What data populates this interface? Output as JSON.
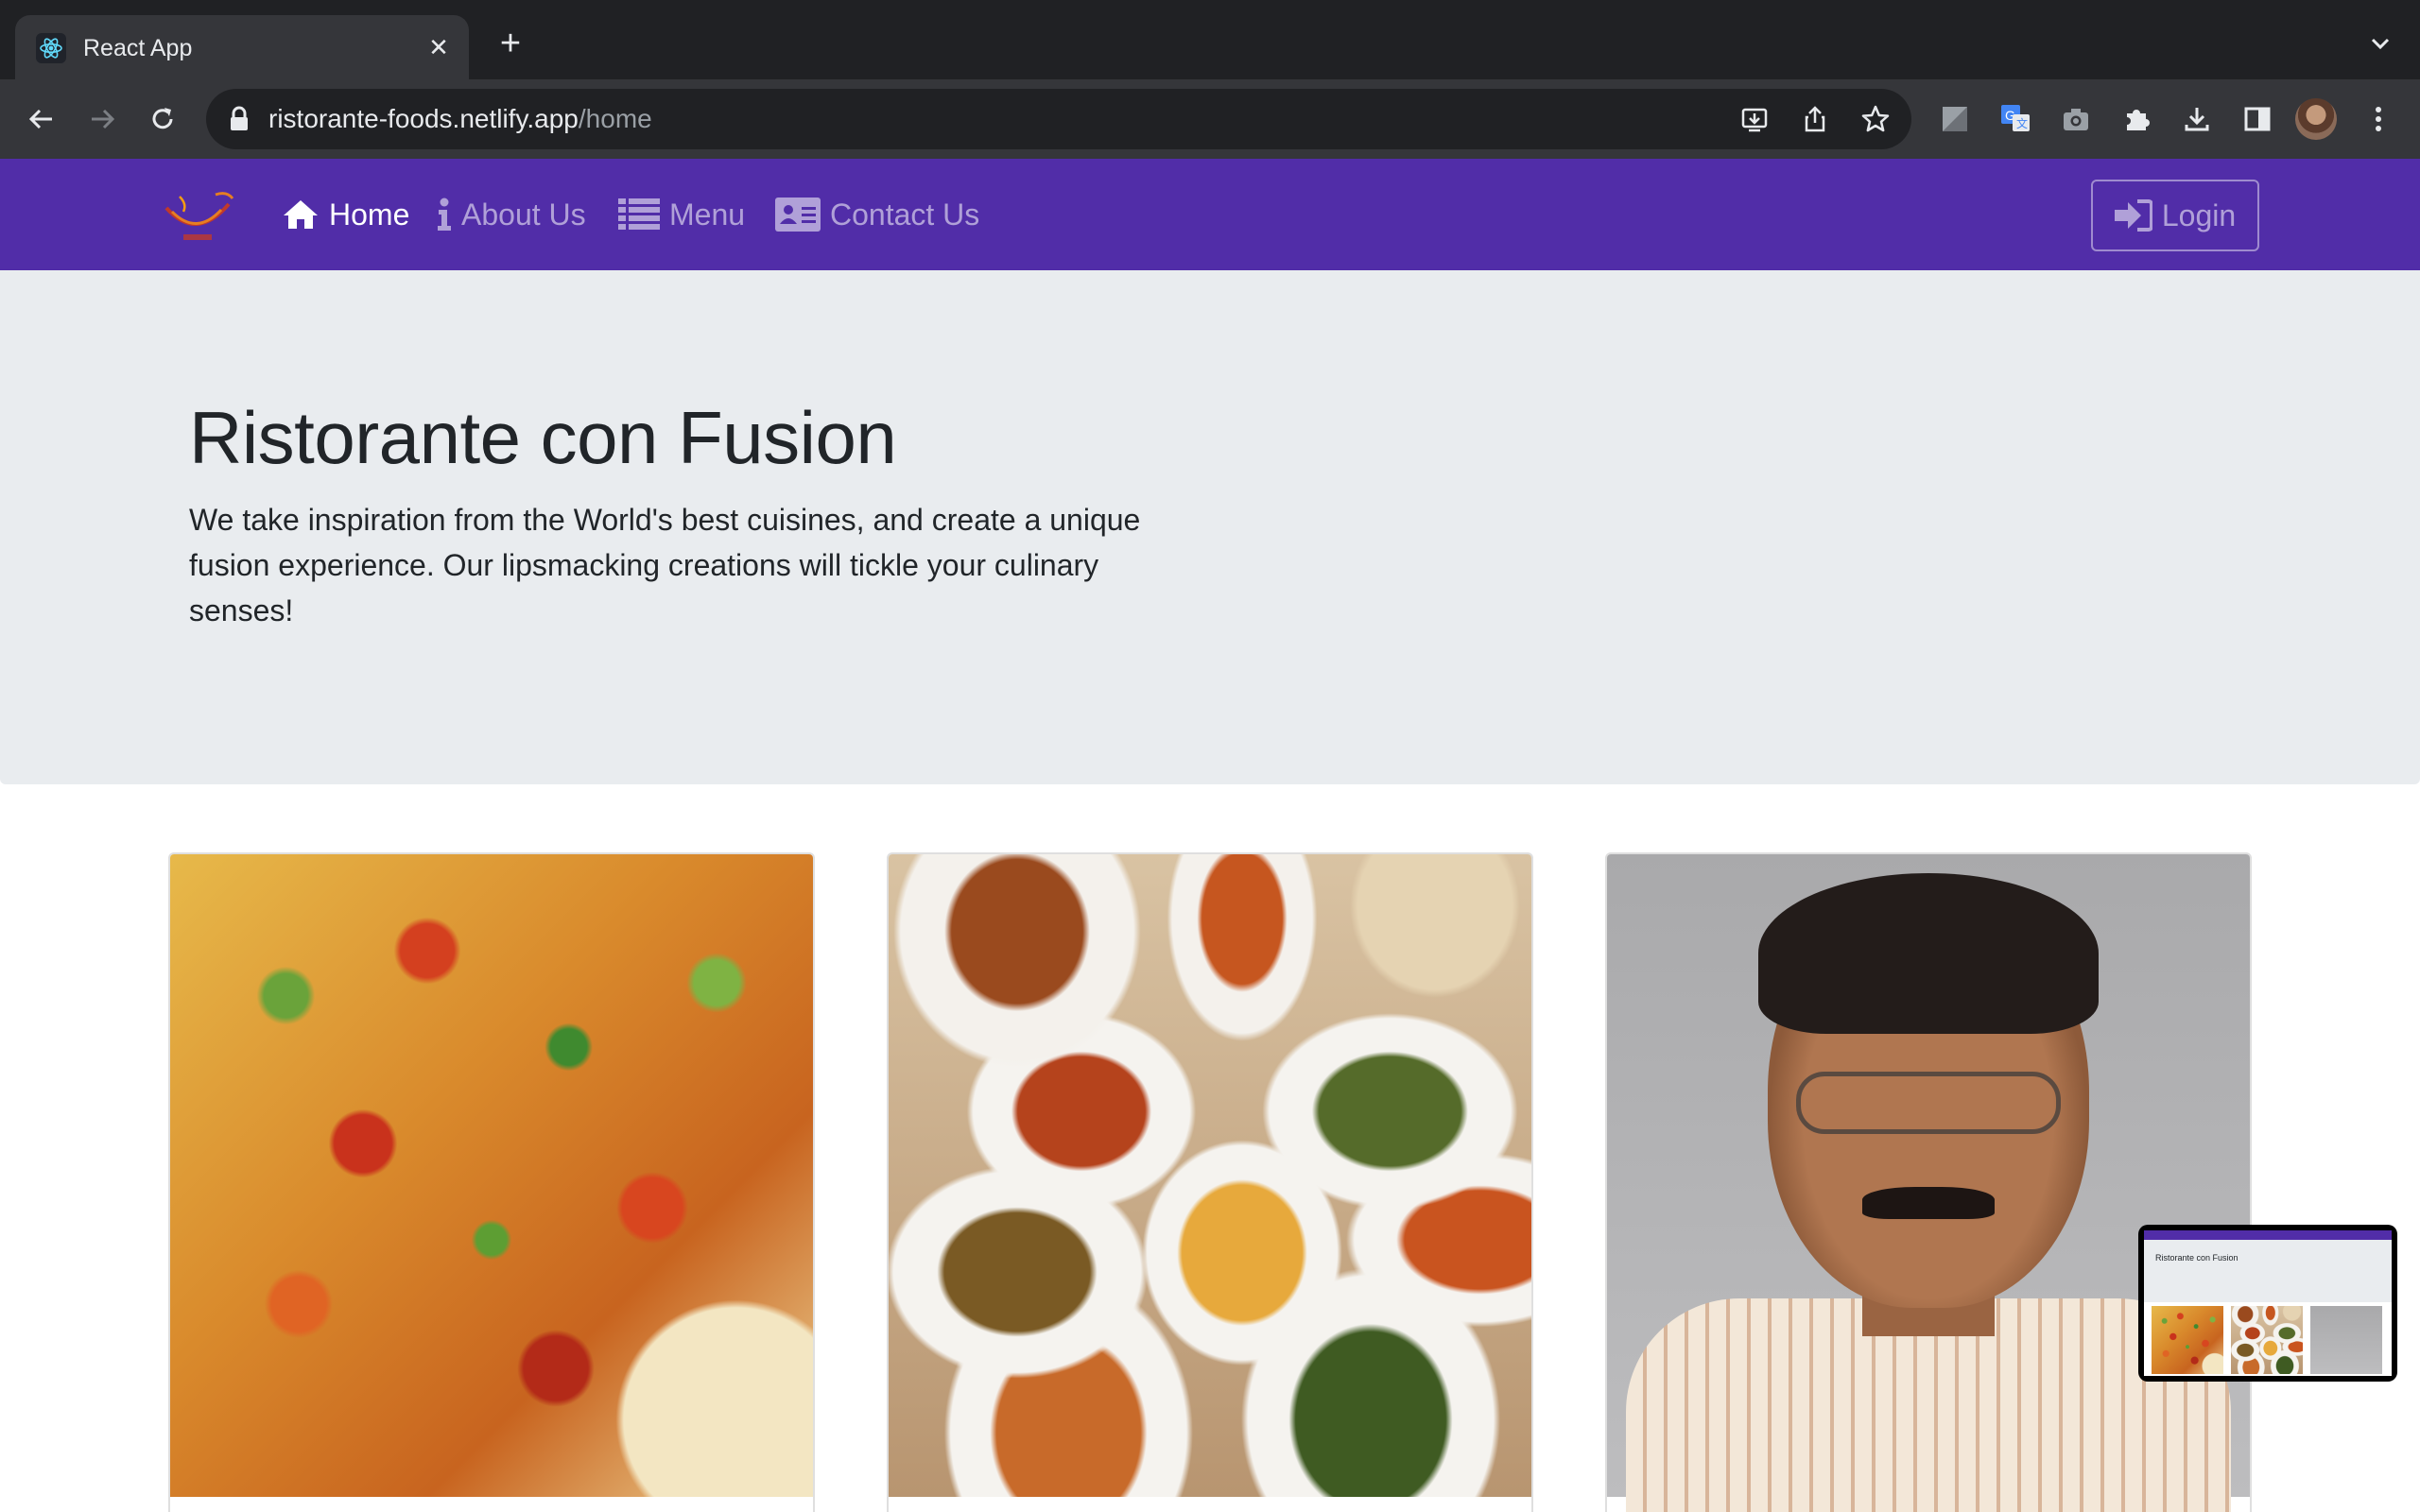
{
  "browser": {
    "tab_title": "React App",
    "url_host": "ristorante-foods.netlify.app",
    "url_path": "/home"
  },
  "site": {
    "nav": {
      "home": "Home",
      "about": "About Us",
      "menu": "Menu",
      "contact": "Contact Us",
      "login": "Login"
    },
    "jumbotron": {
      "title": "Ristorante con Fusion",
      "text": "We take inspiration from the World's best cuisines, and create a unique fusion experience. Our lipsmacking creations will tickle your culinary senses!"
    },
    "pip_title": "Ristorante con Fusion"
  },
  "colors": {
    "navbar": "#512da8",
    "jumbotron": "#e9ecef",
    "chrome_dark": "#202124",
    "chrome_toolbar": "#35363a"
  }
}
